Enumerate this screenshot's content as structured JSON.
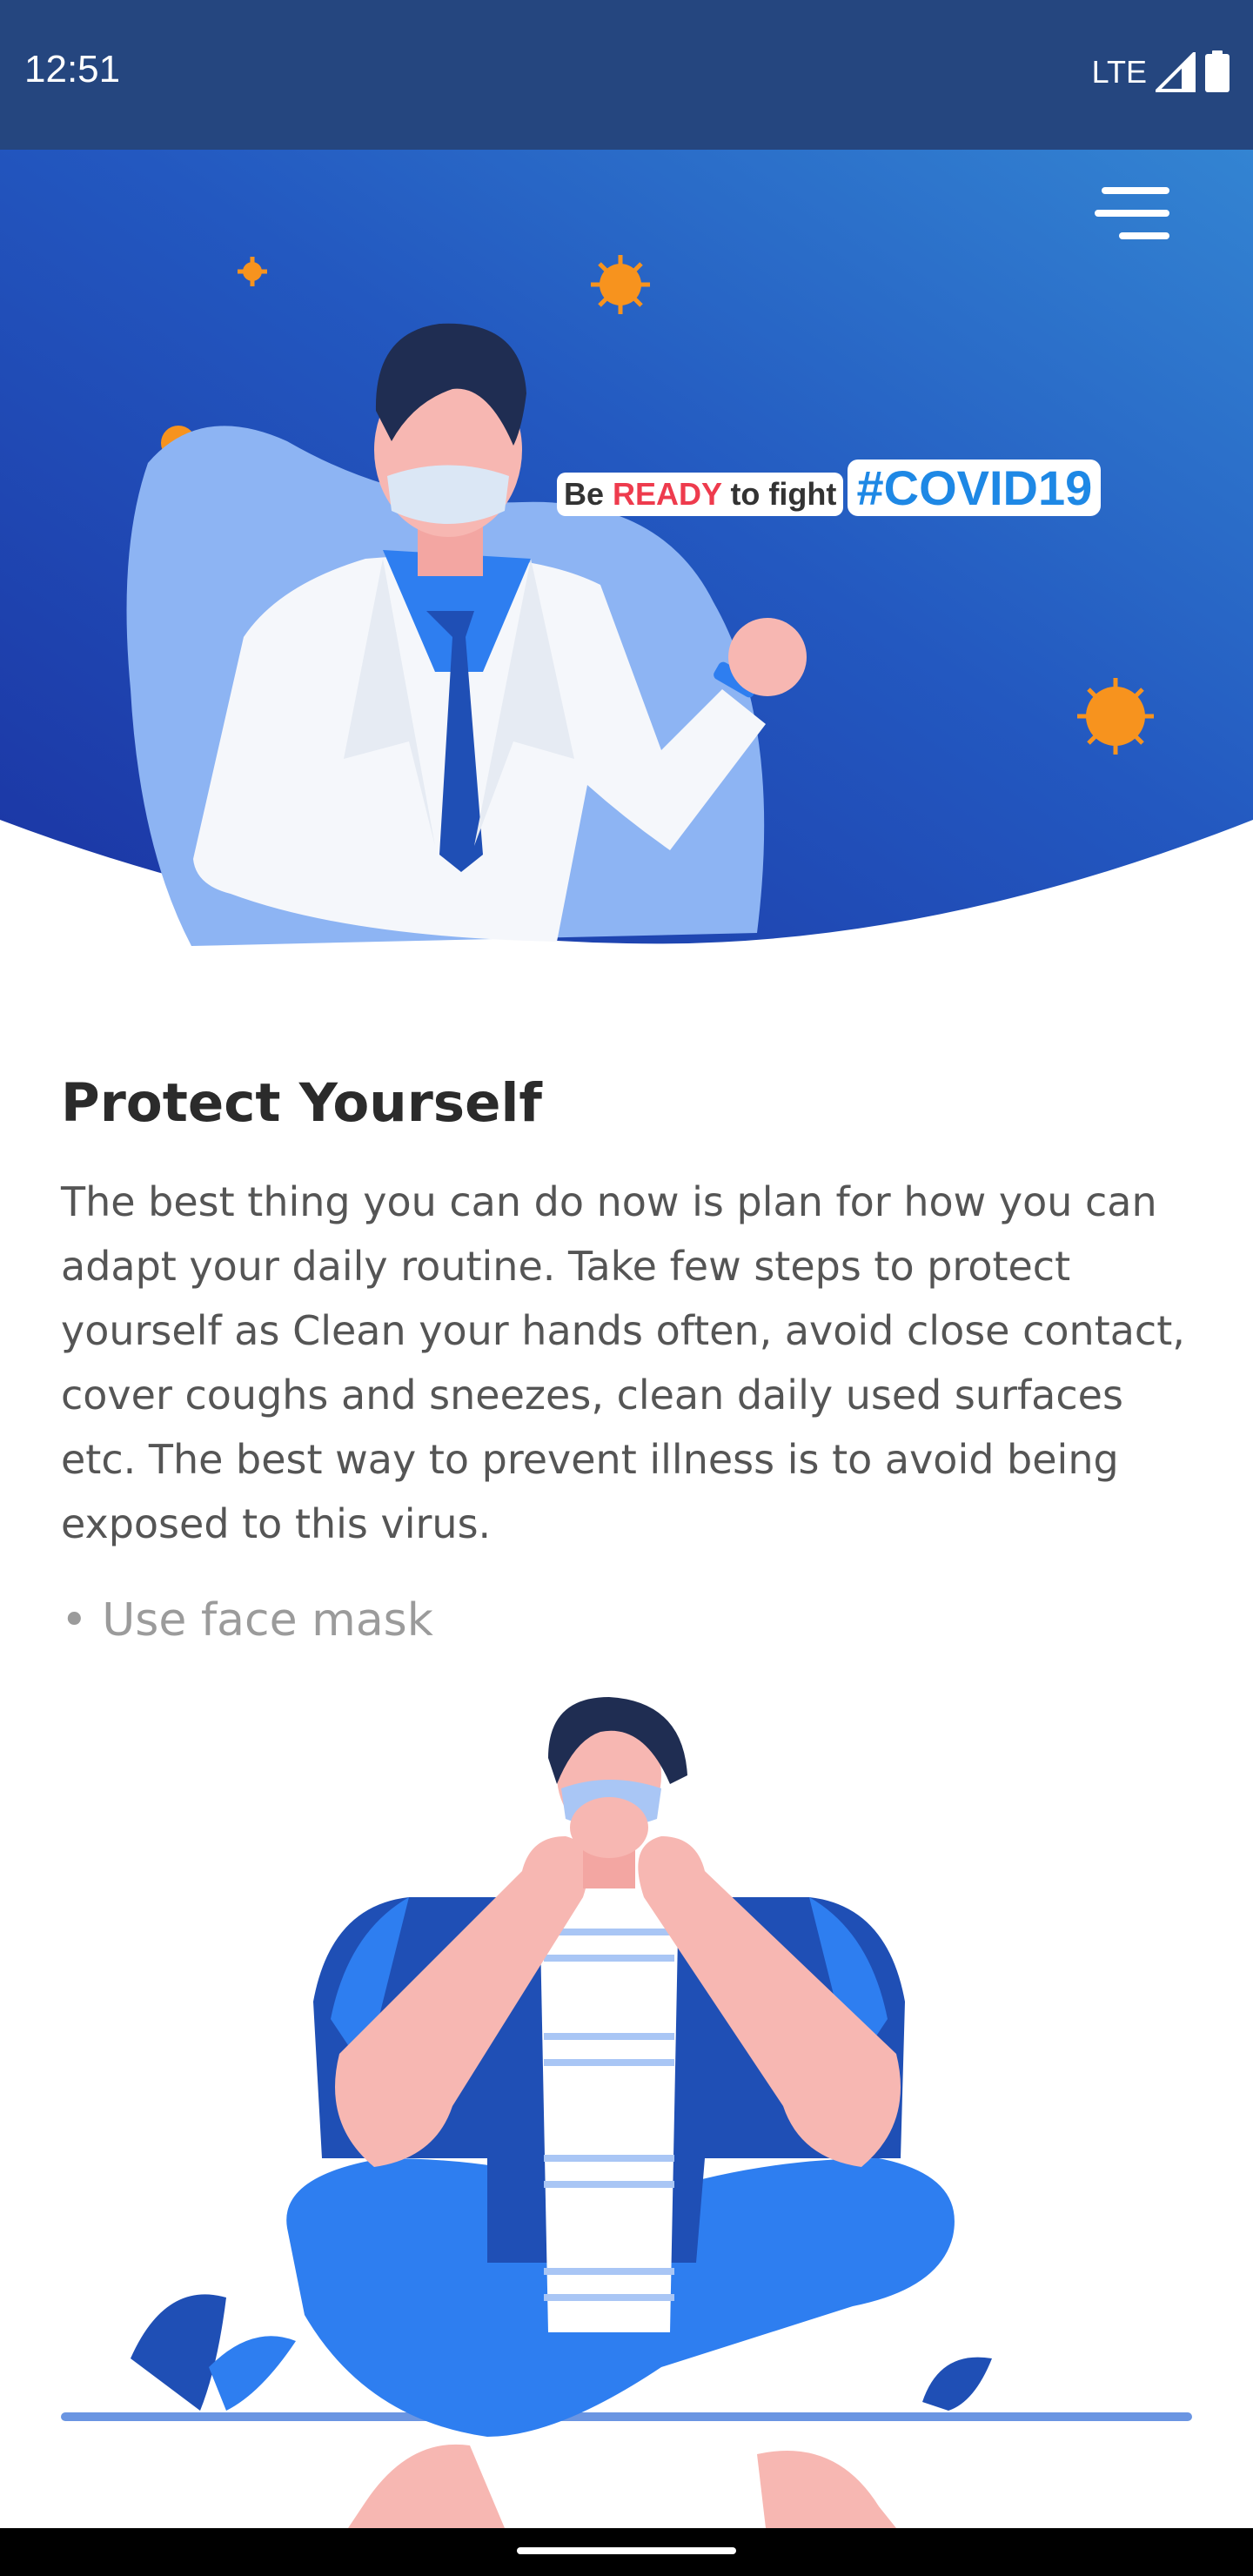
{
  "status_bar": {
    "time": "12:51",
    "network": "LTE",
    "icons": [
      "signal-icon",
      "battery-icon"
    ]
  },
  "hero": {
    "badge_prefix": "Be",
    "badge_highlight": "READY",
    "badge_suffix": "to fight",
    "hashtag": "#COVID19",
    "menu_icon": "hamburger-menu-icon",
    "colors": {
      "gradient_start": "#1b3aa3",
      "gradient_end": "#3384d2",
      "virus": "#f7931e",
      "highlight": "#ee3b4d",
      "hashtag": "#1e88e5"
    }
  },
  "content": {
    "title": "Protect Yourself",
    "paragraph": "The best thing you can do now is plan for how you can adapt your daily routine. Take few steps to protect yourself as Clean your hands often, avoid close contact, cover coughs and sneezes, clean daily used surfaces etc. The best way to prevent illness is to avoid being exposed to this virus.",
    "bullet": "• Use face mask"
  }
}
